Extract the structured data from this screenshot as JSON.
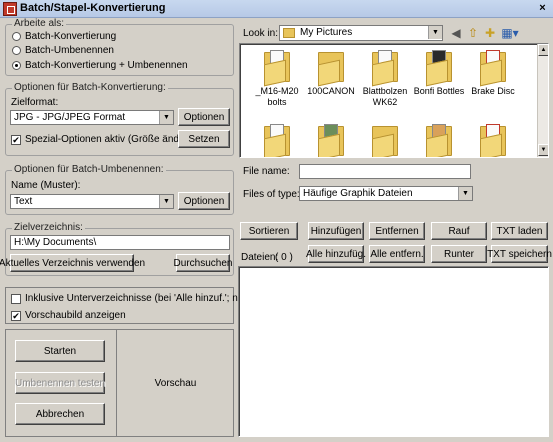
{
  "window": {
    "title": "Batch/Stapel-Konvertierung",
    "close_glyph": "×"
  },
  "arbeite": {
    "legend": "Arbeite als:",
    "options": [
      "Batch-Konvertierung",
      "Batch-Umbenennen",
      "Batch-Konvertierung + Umbenennen"
    ],
    "selected_index": 2
  },
  "konvertierung": {
    "legend": "Optionen für Batch-Konvertierung:",
    "zielformat_label": "Zielformat:",
    "format_value": "JPG - JPG/JPEG Format",
    "optionen_label": "Optionen",
    "spezial_label": "Spezial-Optionen aktiv (Größe ändern etc.)",
    "spezial_checked": true,
    "setzen_label": "Setzen"
  },
  "umbenennen": {
    "legend": "Optionen für Batch-Umbenennen:",
    "name_label": "Name (Muster):",
    "name_value": "Text",
    "optionen_label": "Optionen"
  },
  "ziel": {
    "legend": "Zielverzeichnis:",
    "path_value": "H:\\My Documents\\",
    "use_current_label": "Aktuelles Verzeichnis verwenden",
    "browse_label": "Durchsuchen"
  },
  "flags": {
    "inkl_label": "Inklusive Unterverzeichnisse (bei 'Alle hinzuf.'; nicht gesp.)",
    "inkl_checked": false,
    "vorschau_label": "Vorschaubild anzeigen",
    "vorschau_checked": true
  },
  "actions": {
    "start_label": "Starten",
    "test_label": "Umbenennen testen",
    "cancel_label": "Abbrechen"
  },
  "preview": {
    "label": "Vorschau"
  },
  "browser": {
    "look_in_label": "Look in:",
    "look_in_value": "My Pictures",
    "icons": [
      "back-icon",
      "up-folder-icon",
      "new-folder-icon",
      "view-menu-icon"
    ],
    "folders": [
      {
        "name": "_M16-M20 bolts",
        "lines": [
          "_M16-M20",
          "bolts"
        ]
      },
      {
        "name": "100CANON",
        "lines": [
          "100CANON"
        ]
      },
      {
        "name": "Blattbolzen WK62",
        "lines": [
          "Blattbolzen",
          "WK62"
        ]
      },
      {
        "name": "Bonfi Bottles",
        "lines": [
          "Bonfi Bottles"
        ]
      },
      {
        "name": "Brake Disc",
        "lines": [
          "Brake Disc"
        ]
      },
      {
        "name": "",
        "lines": []
      },
      {
        "name": "",
        "lines": []
      },
      {
        "name": "",
        "lines": []
      },
      {
        "name": "",
        "lines": []
      },
      {
        "name": "",
        "lines": []
      }
    ],
    "filename_label": "File name:",
    "filename_value": "",
    "filetype_label": "Files of type:",
    "filetype_value": "Häufige Graphik Dateien"
  },
  "filelist": {
    "buttons_row1": [
      "Sortieren",
      "Hinzufügen",
      "Entfernen",
      "Rauf",
      "TXT laden"
    ],
    "buttons_row2": [
      "Alle hinzufüg.",
      "Alle entfern.",
      "Runter",
      "TXT speichern"
    ],
    "dateien_label": "Dateien:",
    "dateien_count": "( 0 )"
  }
}
